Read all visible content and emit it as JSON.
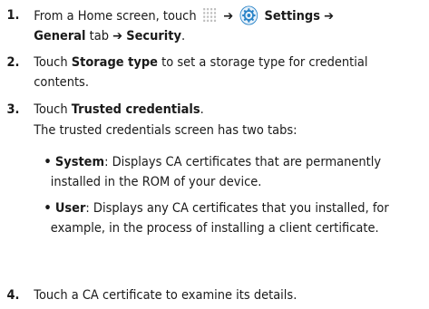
{
  "steps": [
    {
      "number": "1.",
      "line1_a": "From a Home screen, touch",
      "arrow1": "➔",
      "settings_label": "Settings",
      "arrow2": "➔",
      "general_tab": "General",
      "tab_word": "tab",
      "arrow3": "➔",
      "security": "Security",
      "period": "."
    },
    {
      "number": "2.",
      "touch": "Touch",
      "bold": "Storage type",
      "rest": "to set a storage type for credential contents."
    },
    {
      "number": "3.",
      "touch": "Touch",
      "bold": "Trusted credentials",
      "period": ".",
      "description": "The trusted credentials screen has two tabs:"
    },
    {
      "number": "4.",
      "text": "Touch a CA certificate to examine its details."
    }
  ],
  "bullets": [
    {
      "dot": "•",
      "term": "System",
      "text": ": Displays CA certificates that are permanently",
      "text2": "installed in the ROM of your device."
    },
    {
      "dot": "•",
      "term": "User",
      "text": ": Displays any CA certificates that you installed, for",
      "text2": "example, in the process of installing a client certificate."
    }
  ],
  "icons": {
    "apps": "apps-grid-icon",
    "settings": "settings-gear-icon"
  },
  "colors": {
    "text": "#1a1a1a",
    "gear_blue": "#2a84c8",
    "apps_grey": "#bdbdbd"
  }
}
